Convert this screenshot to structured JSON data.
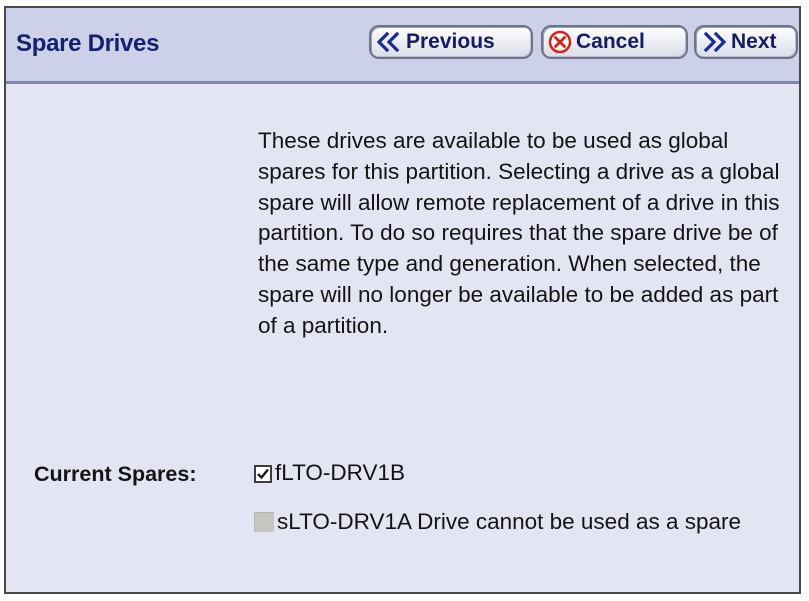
{
  "header": {
    "title": "Spare Drives",
    "previous_label": "Previous",
    "cancel_label": "Cancel",
    "next_label": "Next"
  },
  "content": {
    "description": "These drives are available to be used as global spares for this partition. Selecting a drive as a global spare will allow remote replacement of a drive in this partition. To do so requires that the spare drive be of the same type and generation. When selected, the spare will no longer be available to be added as part of a partition.",
    "current_spares_label": "Current Spares:",
    "spares": [
      {
        "name": "fLTO-DRV1B",
        "checked": true,
        "enabled": true
      },
      {
        "name": "sLTO-DRV1A",
        "note": "Drive cannot be used as a spare",
        "checked": false,
        "enabled": false
      }
    ]
  },
  "colors": {
    "header_bg": "#ccd1e9",
    "body_bg": "#e3e6f2",
    "title_text": "#15206e",
    "cancel_icon_red": "#d8201a"
  },
  "icons": {
    "previous": "double-chevron-left-icon",
    "cancel": "cancel-x-circle-icon",
    "next": "double-chevron-right-icon"
  }
}
